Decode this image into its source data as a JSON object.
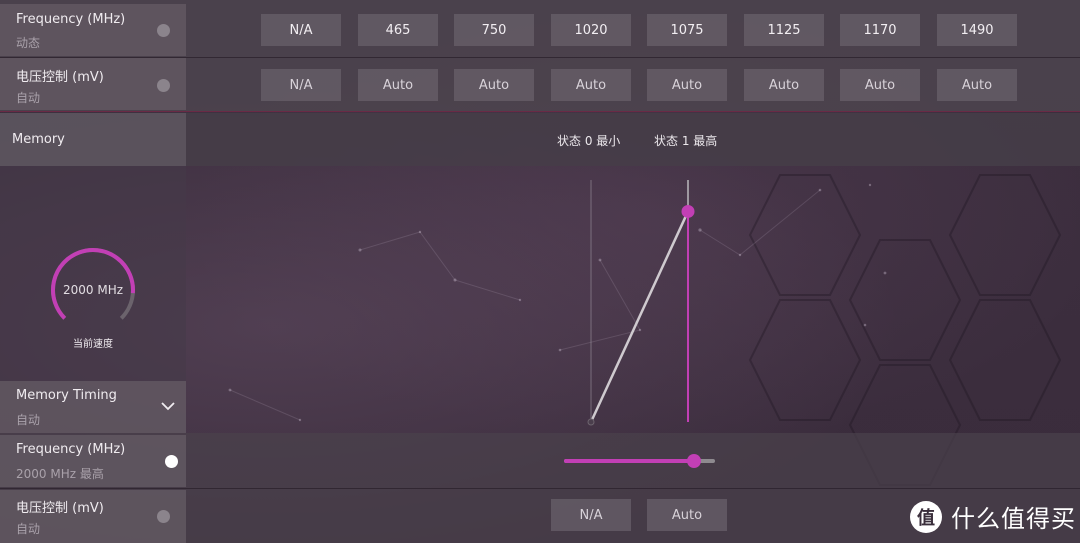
{
  "gpu_rows": {
    "frequency": {
      "title": "Frequency (MHz)",
      "subtitle": "动态",
      "toggle_on": false,
      "values": [
        "N/A",
        "465",
        "750",
        "1020",
        "1075",
        "1125",
        "1170",
        "1490"
      ]
    },
    "voltage": {
      "title": "电压控制 (mV)",
      "subtitle": "自动",
      "toggle_on": false,
      "values": [
        "N/A",
        "Auto",
        "Auto",
        "Auto",
        "Auto",
        "Auto",
        "Auto",
        "Auto"
      ]
    }
  },
  "memory": {
    "header_label": "Memory",
    "states": [
      "状态 0 最小",
      "状态 1 最高"
    ],
    "gauge": {
      "value_text": "2000 MHz",
      "caption": "当前速度",
      "fill_fraction": 0.85
    },
    "state_curve": {
      "points": [
        {
          "state": 0,
          "level": 0.0
        },
        {
          "state": 1,
          "level": 0.87
        }
      ]
    },
    "timing": {
      "title": "Memory Timing",
      "subtitle": "自动"
    },
    "frequency": {
      "title": "Frequency (MHz)",
      "subtitle": "2000 MHz 最高",
      "toggle_on": true,
      "slider_fraction": 0.86
    },
    "voltage": {
      "title": "电压控制 (mV)",
      "subtitle": "自动",
      "toggle_on": false,
      "values": [
        "N/A",
        "Auto"
      ]
    }
  },
  "colors": {
    "accent": "#c23fb5",
    "track": "#8e8a8f",
    "curve_line": "#cfcacf"
  },
  "watermark": {
    "badge": "值",
    "text": "什么值得买"
  }
}
